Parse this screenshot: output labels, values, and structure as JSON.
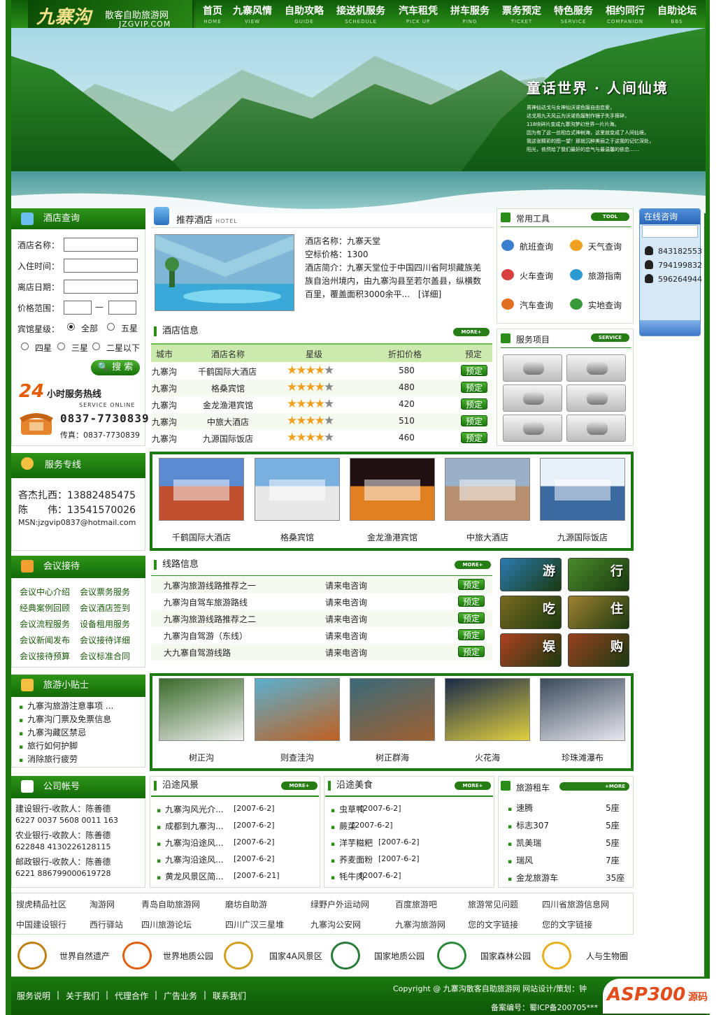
{
  "site": {
    "logo_text": "九寨沟",
    "logo_subtitle": "散客自助旅游网",
    "domain": "JZGVIP.COM"
  },
  "nav": [
    {
      "cn": "首页",
      "en": "HOME"
    },
    {
      "cn": "九寨风情",
      "en": "VIEW"
    },
    {
      "cn": "自助攻略",
      "en": "GUIDE"
    },
    {
      "cn": "接送机服务",
      "en": "SCHEDULE"
    },
    {
      "cn": "汽车租凭",
      "en": "PICK UP"
    },
    {
      "cn": "拼车服务",
      "en": "PING"
    },
    {
      "cn": "票务预定",
      "en": "TICKET"
    },
    {
      "cn": "特色服务",
      "en": "SERVICE"
    },
    {
      "cn": "相约同行",
      "en": "COMPANION"
    },
    {
      "cn": "自助论坛",
      "en": "BBS"
    }
  ],
  "banner": {
    "title": "童话世界 · 人间仙境",
    "lines": [
      "男神仙达戈与女神仙沃诺色嫫自由恋爱，",
      "达戈用九天风云为沃诺色嫫制作镜子失手摔碎，",
      "118块碎片变成九寨沟梦幻世界一片片海。",
      "因为有了这一丝相合式神树海，这里就变成了人间仙境，",
      "我这张精彩的图一望！那就沉醉美丽之于这我的记忆深处，",
      "阳光，依然给了我们最好的恋气与最温馨的依恋……"
    ]
  },
  "hotel_search": {
    "title": "酒店查询",
    "fields": [
      {
        "label": "酒店名称：",
        "value": ""
      },
      {
        "label": "入住时间：",
        "value": ""
      },
      {
        "label": "离店日期：",
        "value": ""
      }
    ],
    "price_label": "价格范围：",
    "price_dash": "—",
    "star_label": "宾馆星级：",
    "star_options": [
      "全部",
      "五星",
      "四星",
      "三星",
      "二星以下"
    ],
    "search_button": "搜 索",
    "hotline_prefix": "24",
    "hotline_text": "小时服务热线",
    "hotline_en": "SERVICE ONLINE",
    "hotline_number": "0837-7730839",
    "fax": "传真：0837-7730839"
  },
  "recommend": {
    "title": "推荐酒店",
    "title_en": "HOTEL",
    "name": "酒店名称：九寨天堂",
    "price": "空标价格：1300",
    "intro": "酒店简介：九寨天堂位于中国四川省阿坝藏族羌族自治州境内，由九寨沟县至若尔盖县，纵横数百里，覆盖面积3000余平...",
    "detail": "[详细]"
  },
  "hotel_info": {
    "title": "酒店信息",
    "more": "MORE+",
    "headers": [
      "城市",
      "酒店名称",
      "星级",
      "折扣价格",
      "预定"
    ],
    "rows": [
      {
        "city": "九寨沟",
        "name": "千鹤国际大酒店",
        "stars": 4,
        "price": "580",
        "book": "预定"
      },
      {
        "city": "九寨沟",
        "name": "格桑宾馆",
        "stars": 4,
        "price": "480",
        "book": "预定"
      },
      {
        "city": "九寨沟",
        "name": "金龙渔港宾馆",
        "stars": 4,
        "price": "420",
        "book": "预定"
      },
      {
        "city": "九寨沟",
        "name": "中旅大酒店",
        "stars": 4,
        "price": "510",
        "book": "预定"
      },
      {
        "city": "九寨沟",
        "name": "九源国际饭店",
        "stars": 4,
        "price": "460",
        "book": "预定"
      }
    ]
  },
  "tools": {
    "title": "常用工具",
    "tag": "TOOL",
    "items": [
      {
        "label": "航班查询",
        "icon": "globe-icon"
      },
      {
        "label": "天气查询",
        "icon": "weather-icon"
      },
      {
        "label": "火车查询",
        "icon": "train-icon"
      },
      {
        "label": "旅游指南",
        "icon": "book-icon"
      },
      {
        "label": "汽车查询",
        "icon": "bus-icon"
      },
      {
        "label": "实地查询",
        "icon": "cube-icon"
      }
    ]
  },
  "services": {
    "title": "服务项目",
    "tag": "SERVICE",
    "items": [
      "airplane-icon",
      "phone-icon",
      "car-icon",
      "bus-icon",
      "hotel-icon",
      "food-icon"
    ]
  },
  "online": {
    "title": "在线咨询",
    "qq": [
      "843182553",
      "794199832",
      "596264944"
    ]
  },
  "hotline": {
    "title": "服务专线",
    "lines": [
      "吝杰扎西：13882485475",
      "陈　　伟：13541570026"
    ],
    "msn": "MSN:jzgvip0837@hotmail.com"
  },
  "hotel_gallery": [
    "千鹤国际大酒店",
    "格桑宾馆",
    "金龙渔港宾馆",
    "中旅大酒店",
    "九源国际饭店"
  ],
  "meeting": {
    "title": "会议接待",
    "items": [
      "会议中心介绍",
      "会议票务服务",
      "经典案例回顾",
      "会议酒店签到",
      "会议流程服务",
      "设备租用服务",
      "会议新闻发布",
      "会议接待详细",
      "会议接待预算",
      "会议标准合同"
    ]
  },
  "routes": {
    "title": "线路信息",
    "more": "MORE+",
    "rows": [
      {
        "name": "九寨沟旅游线路推荐之一",
        "price": "请来电咨询",
        "book": "预定"
      },
      {
        "name": "九寨沟自驾车旅游路线",
        "price": "请来电咨询",
        "book": "预定"
      },
      {
        "name": "九寨沟旅游线路推荐之二",
        "price": "请来电咨询",
        "book": "预定"
      },
      {
        "name": "九寨沟自驾游（东线）",
        "price": "请来电咨询",
        "book": "预定"
      },
      {
        "name": "大九寨自驾游线路",
        "price": "请来电咨询",
        "book": "预定"
      }
    ]
  },
  "six": [
    "游",
    "行",
    "吃",
    "住",
    "娱",
    "购"
  ],
  "tips": {
    "title": "旅游小贴士",
    "items": [
      "九寨沟旅游注意事项 ...",
      "九寨沟门票及免票信息",
      "九寨沟藏区禁忌",
      "旅行如何护脚",
      "消除旅行疲劳"
    ]
  },
  "scenery_gallery": [
    "树正沟",
    "则查洼沟",
    "树正群海",
    "火花海",
    "珍珠滩瀑布"
  ],
  "account": {
    "title": "公司帐号",
    "lines": [
      "建设银行-收款人：陈善德",
      "6227 0037 5608 0011 163",
      "农业银行-收款人：陈善德",
      "622848 4130226128115",
      "邮政银行-收款人：陈善德",
      "6221 886799000619728"
    ]
  },
  "scenery": {
    "title": "沿途风景",
    "more": "MORE+",
    "items": [
      {
        "t": "九寨沟风光介...",
        "d": "[2007-6-2]"
      },
      {
        "t": "成都到九寨沟...",
        "d": "[2007-6-2]"
      },
      {
        "t": "九寨沟沿途风...",
        "d": "[2007-6-2]"
      },
      {
        "t": "九寨沟沿途风...",
        "d": "[2007-6-2]"
      },
      {
        "t": "黄龙风景区简...",
        "d": "[2007-6-21]"
      }
    ]
  },
  "food": {
    "title": "沿途美食",
    "more": "MORE+",
    "items": [
      {
        "t": "虫草鸭",
        "d": "[2007-6-2]"
      },
      {
        "t": "蕨菜",
        "d": "[2007-6-2]"
      },
      {
        "t": "洋芋糍粑",
        "d": "[2007-6-2]"
      },
      {
        "t": "荞麦面粉",
        "d": "[2007-6-2]"
      },
      {
        "t": "牦牛肉",
        "d": "[2007-6-2]"
      }
    ]
  },
  "rental": {
    "title": "旅游租车",
    "more": "+MORE",
    "items": [
      {
        "car": "速腾",
        "seats": "5座"
      },
      {
        "car": "标志307",
        "seats": "5座"
      },
      {
        "car": "凯美瑞",
        "seats": "5座"
      },
      {
        "car": "瑞风",
        "seats": "7座"
      },
      {
        "car": "金龙旅游车",
        "seats": "35座"
      }
    ]
  },
  "friend_links": [
    [
      "搜虎精品社区",
      "淘游网",
      "青岛自助旅游网",
      "磨坊自助游",
      "绿野户外运动网",
      "百度旅游吧",
      "旅游常见问题",
      "四川省旅游信息网"
    ],
    [
      "中国建设银行",
      "西行驿站",
      "四川旅游论坛",
      "四川广汉三星堆",
      "九寨沟公安网",
      "九寨沟旅游网",
      "您的文字链接",
      "您的文字链接"
    ]
  ],
  "certs": [
    "世界自然遗产",
    "世界地质公园",
    "国家4A风景区",
    "国家地质公园",
    "国家森林公园",
    "人与生物圈"
  ],
  "footer": {
    "links": [
      "服务说明",
      "关于我们",
      "代理合作",
      "广告业务",
      "联系我们"
    ],
    "copyright": "Copyright @ 九寨沟散客自助旅游网 网站设计/策划：钟",
    "icp": "备案编号：蜀ICP备200705***",
    "watermark": "ASP300",
    "watermark_sub": "源码"
  },
  "colors": {
    "primary": "#1d7a10",
    "accent": "#f0a020"
  }
}
